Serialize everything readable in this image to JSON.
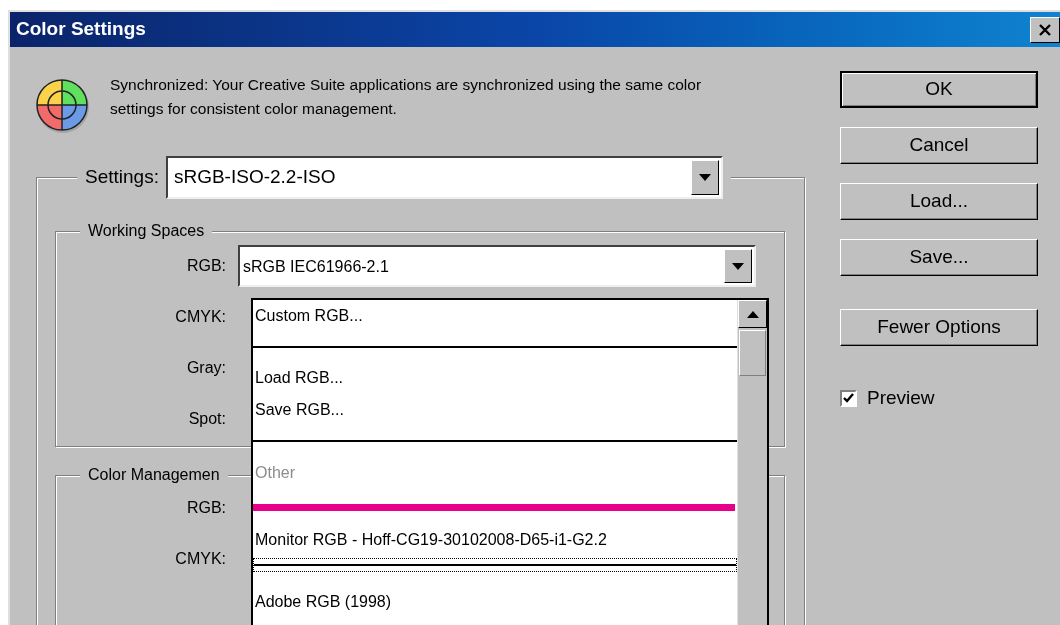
{
  "window": {
    "title": "Color Settings"
  },
  "sync": {
    "message": "Synchronized: Your Creative Suite applications are synchronized using the same color settings for consistent color management."
  },
  "settings": {
    "label": "Settings:",
    "value": "sRGB-ISO-2.2-ISO"
  },
  "working_spaces": {
    "title": "Working Spaces",
    "rows": [
      {
        "label": "RGB:",
        "value": "sRGB IEC61966-2.1"
      },
      {
        "label": "CMYK:"
      },
      {
        "label": "Gray:"
      },
      {
        "label": "Spot:"
      }
    ]
  },
  "rgb_menu": {
    "items": [
      {
        "kind": "option",
        "label": "Custom RGB..."
      },
      {
        "kind": "separator",
        "focused": false
      },
      {
        "kind": "option",
        "label": "Load RGB..."
      },
      {
        "kind": "option",
        "label": "Save RGB..."
      },
      {
        "kind": "separator",
        "focused": false
      },
      {
        "kind": "heading",
        "label": "Other"
      },
      {
        "kind": "bar"
      },
      {
        "kind": "option",
        "label": "Monitor RGB - Hoff-CG19-30102008-D65-i1-G2.2"
      },
      {
        "kind": "separator",
        "focused": true
      },
      {
        "kind": "option",
        "label": "Adobe RGB (1998)"
      }
    ]
  },
  "color_management": {
    "title": "Color Managemen",
    "rows": [
      {
        "label": "RGB:"
      },
      {
        "label": "CMYK:"
      }
    ]
  },
  "buttons": [
    {
      "label": "OK",
      "default": true
    },
    {
      "label": "Cancel",
      "default": false
    },
    {
      "label": "Load...",
      "default": false
    },
    {
      "label": "Save...",
      "default": false
    },
    {
      "label": "Fewer Options",
      "default": false
    }
  ],
  "preview": {
    "label": "Preview",
    "checked": true
  }
}
